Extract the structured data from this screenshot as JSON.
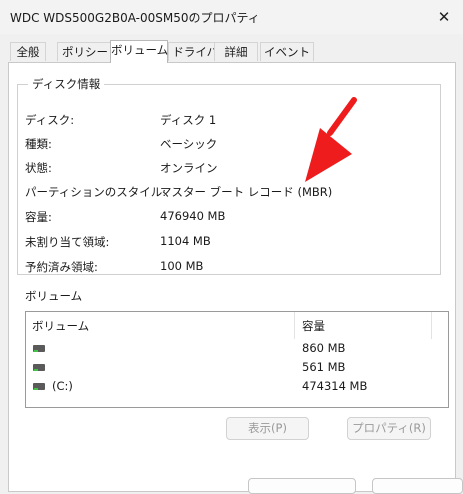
{
  "window": {
    "title": "WDC  WDS500G2B0A-00SM50のプロパティ",
    "close_glyph": "✕"
  },
  "tabs": [
    {
      "label": "全般",
      "active": false
    },
    {
      "label": "ポリシー",
      "active": false
    },
    {
      "label": "ボリューム",
      "active": true
    },
    {
      "label": "ドライバー",
      "active": false
    },
    {
      "label": "詳細",
      "active": false
    },
    {
      "label": "イベント",
      "active": false
    }
  ],
  "disk_info": {
    "title": "ディスク情報",
    "rows": [
      {
        "label": "ディスク:",
        "value": "ディスク 1"
      },
      {
        "label": "種類:",
        "value": "ベーシック"
      },
      {
        "label": "状態:",
        "value": "オンライン"
      },
      {
        "label": "パーティションのスタイル:",
        "value": "マスター ブート レコード (MBR)"
      },
      {
        "label": "容量:",
        "value": "476940 MB"
      },
      {
        "label": "未割り当て領域:",
        "value": "1104 MB"
      },
      {
        "label": "予約済み領域:",
        "value": "100 MB"
      }
    ]
  },
  "volumes": {
    "heading": "ボリューム",
    "columns": [
      "ボリューム",
      "容量"
    ],
    "rows": [
      {
        "name": "",
        "capacity": "860 MB",
        "icon": "drive-icon"
      },
      {
        "name": "",
        "capacity": "561 MB",
        "icon": "drive-icon"
      },
      {
        "name": "(C:)",
        "capacity": "474314 MB",
        "icon": "drive-icon"
      }
    ]
  },
  "buttons": {
    "show": "表示(P)",
    "properties": "プロパティ(R)"
  },
  "annotation": {
    "arrow_color": "#ee1c1c"
  }
}
